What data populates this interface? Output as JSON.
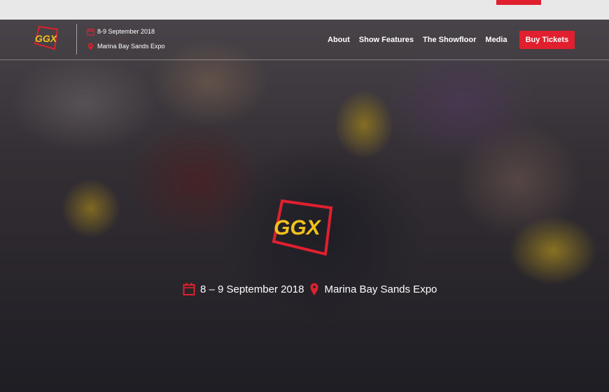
{
  "header": {
    "date": "8-9 September 2018",
    "venue": "Marina Bay Sands Expo",
    "nav": [
      "About",
      "Show Features",
      "The Showfloor",
      "Media"
    ],
    "cta": "Buy Tickets"
  },
  "hero": {
    "date": "8 – 9 September 2018",
    "venue": "Marina Bay Sands Expo"
  },
  "colors": {
    "accent": "#e0202e",
    "logo_yellow": "#f2c21b"
  },
  "icons": [
    "calendar-icon",
    "location-pin-icon",
    "ggx-logo"
  ]
}
